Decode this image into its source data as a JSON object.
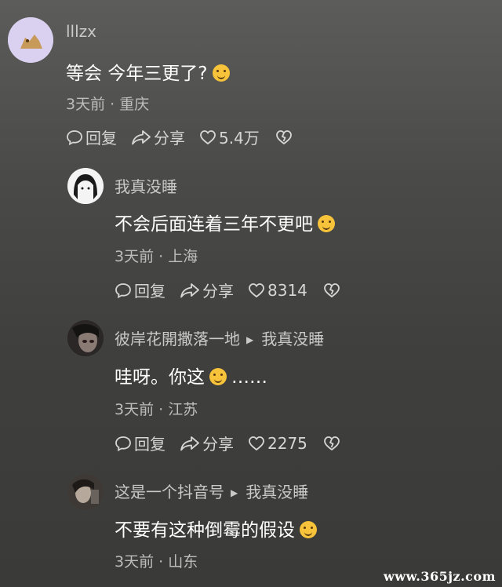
{
  "comments": [
    {
      "username": "lllzx",
      "text": "等会 今年三更了?",
      "emoji": "smiling-emoji",
      "time": "3天前",
      "location": "重庆",
      "reply_label": "回复",
      "share_label": "分享",
      "likes": "5.4万"
    },
    {
      "username": "我真没睡",
      "text": "不会后面连着三年不更吧",
      "emoji": "laughing-emoji",
      "time": "3天前",
      "location": "上海",
      "reply_label": "回复",
      "share_label": "分享",
      "likes": "8314"
    },
    {
      "username": "彼岸花開撒落一地",
      "reply_to": "我真没睡",
      "text": "哇呀。你这",
      "text_suffix": "……",
      "emoji": "sweat-smile-emoji",
      "time": "3天前",
      "location": "江苏",
      "reply_label": "回复",
      "share_label": "分享",
      "likes": "2275"
    },
    {
      "username": "这是一个抖音号",
      "reply_to": "我真没睡",
      "text": "不要有这种倒霉的假设",
      "emoji": "laughing-emoji",
      "time": "3天前",
      "location": "山东"
    }
  ],
  "watermark": "www.365jz.com",
  "colors": {
    "background": "#4a4a48",
    "meta": "#bdbdbb",
    "emoji": "#f6c33a"
  }
}
